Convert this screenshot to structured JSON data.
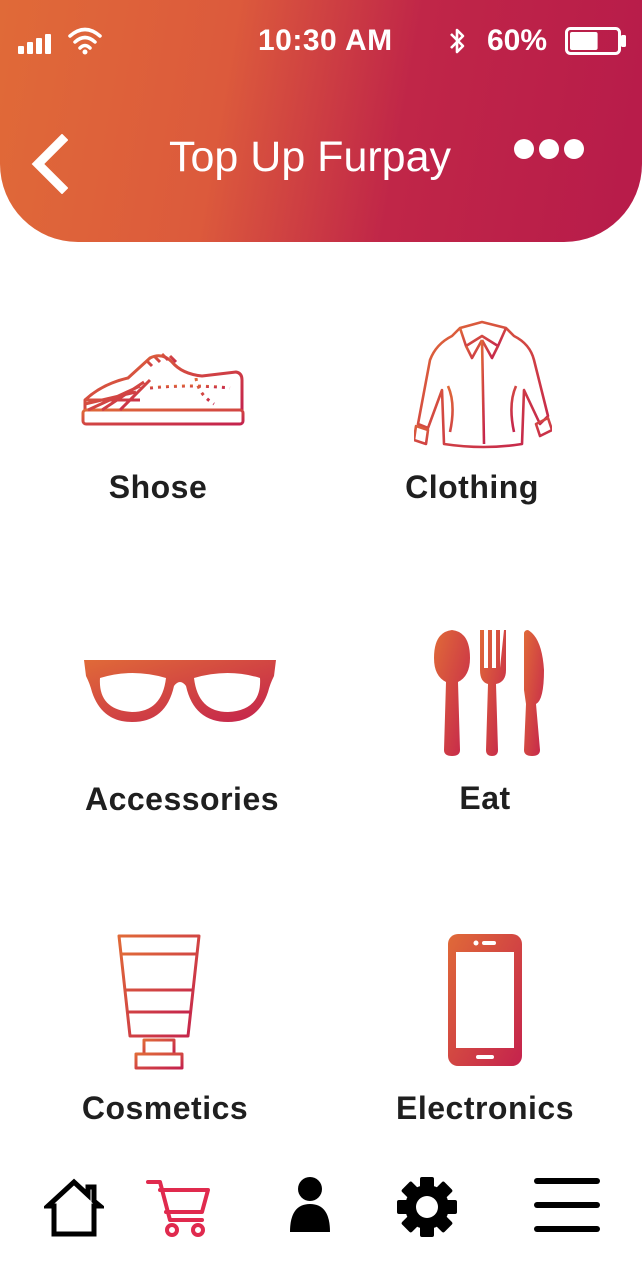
{
  "status_bar": {
    "time": "10:30 AM",
    "battery_percent": "60%",
    "battery_level": 0.6
  },
  "header": {
    "title": "Top Up Furpay",
    "back_icon": "chevron-left-icon",
    "more_icon": "more-horizontal-icon"
  },
  "categories": [
    {
      "label": "Shose",
      "icon": "shoe-icon"
    },
    {
      "label": "Clothing",
      "icon": "shirt-icon"
    },
    {
      "label": "Accessories",
      "icon": "glasses-icon"
    },
    {
      "label": "Eat",
      "icon": "cutlery-icon"
    },
    {
      "label": "Cosmetics",
      "icon": "cosmetic-tube-icon"
    },
    {
      "label": "Electronics",
      "icon": "smartphone-icon"
    }
  ],
  "bottom_nav": [
    {
      "icon": "home-icon"
    },
    {
      "icon": "cart-icon",
      "active": true
    },
    {
      "icon": "user-icon"
    },
    {
      "icon": "settings-icon"
    },
    {
      "icon": "menu-icon"
    }
  ],
  "colors": {
    "gradient_start": "#e06a38",
    "gradient_end": "#b71b4a",
    "active_nav": "#e02a4e",
    "label_text": "#1f1f1f"
  }
}
